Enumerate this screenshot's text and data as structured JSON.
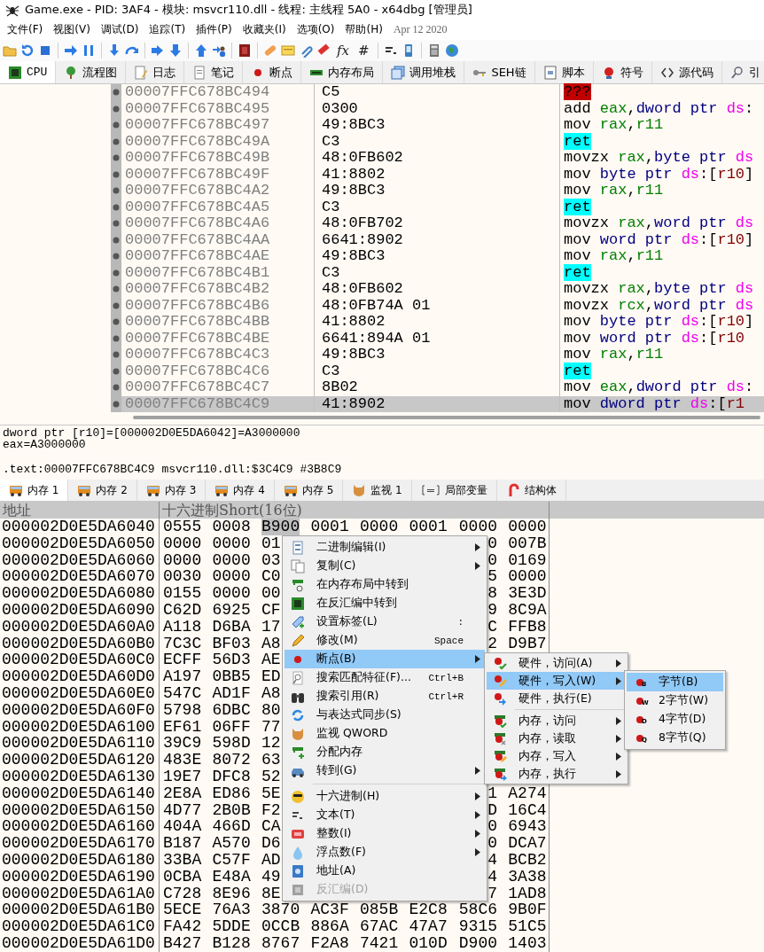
{
  "window": {
    "title": "Game.exe - PID: 3AF4 - 模块: msvcr110.dll - 线程: 主线程 5A0 - x64dbg [管理员]"
  },
  "menu_bar": {
    "items": [
      "文件(F)",
      "视图(V)",
      "调试(D)",
      "追踪(T)",
      "插件(P)",
      "收藏夹(I)",
      "选项(O)",
      "帮助(H)"
    ],
    "build_date": "Apr 12 2020"
  },
  "toolbar": {
    "text_buttons": [
      "fx",
      "#"
    ]
  },
  "tabs": [
    {
      "label": "CPU",
      "selected": true
    },
    {
      "label": "流程图",
      "selected": false
    },
    {
      "label": "日志",
      "selected": false
    },
    {
      "label": "笔记",
      "selected": false
    },
    {
      "label": "断点",
      "selected": false
    },
    {
      "label": "内存布局",
      "selected": false
    },
    {
      "label": "调用堆栈",
      "selected": false
    },
    {
      "label": "SEH链",
      "selected": false
    },
    {
      "label": "脚本",
      "selected": false
    },
    {
      "label": "符号",
      "selected": false
    },
    {
      "label": "源代码",
      "selected": false
    },
    {
      "label": "引",
      "selected": false
    }
  ],
  "disassembly": {
    "rows": [
      {
        "address": "00007FFC678BC494",
        "bytes": "C5",
        "selected": false,
        "instruction": [
          {
            "text": "???",
            "kind": "bad"
          }
        ]
      },
      {
        "address": "00007FFC678BC495",
        "bytes": "0300",
        "selected": false,
        "instruction": [
          {
            "text": "add ",
            "kind": "op"
          },
          {
            "text": "eax",
            "kind": "reg"
          },
          {
            "text": ",",
            "kind": "punct"
          },
          {
            "text": "dword ptr ",
            "kind": "size"
          },
          {
            "text": "ds",
            "kind": "seg"
          },
          {
            "text": ":",
            "kind": "punct"
          }
        ]
      },
      {
        "address": "00007FFC678BC497",
        "bytes": "49:8BC3",
        "selected": false,
        "instruction": [
          {
            "text": "mov ",
            "kind": "op"
          },
          {
            "text": "rax",
            "kind": "reg"
          },
          {
            "text": ",",
            "kind": "punct"
          },
          {
            "text": "r11",
            "kind": "reg"
          }
        ]
      },
      {
        "address": "00007FFC678BC49A",
        "bytes": "C3",
        "selected": false,
        "instruction": [
          {
            "text": "ret",
            "kind": "ret"
          }
        ]
      },
      {
        "address": "00007FFC678BC49B",
        "bytes": "48:0FB602",
        "selected": false,
        "instruction": [
          {
            "text": "movzx ",
            "kind": "op"
          },
          {
            "text": "rax",
            "kind": "reg"
          },
          {
            "text": ",",
            "kind": "punct"
          },
          {
            "text": "byte ptr ",
            "kind": "size"
          },
          {
            "text": "ds",
            "kind": "seg"
          }
        ]
      },
      {
        "address": "00007FFC678BC49F",
        "bytes": "41:8802",
        "selected": false,
        "instruction": [
          {
            "text": "mov ",
            "kind": "op"
          },
          {
            "text": "byte ptr ",
            "kind": "size"
          },
          {
            "text": "ds",
            "kind": "seg"
          },
          {
            "text": ":[",
            "kind": "punct"
          },
          {
            "text": "r10",
            "kind": "mem"
          },
          {
            "text": "]",
            "kind": "punct"
          }
        ]
      },
      {
        "address": "00007FFC678BC4A2",
        "bytes": "49:8BC3",
        "selected": false,
        "instruction": [
          {
            "text": "mov ",
            "kind": "op"
          },
          {
            "text": "rax",
            "kind": "reg"
          },
          {
            "text": ",",
            "kind": "punct"
          },
          {
            "text": "r11",
            "kind": "reg"
          }
        ]
      },
      {
        "address": "00007FFC678BC4A5",
        "bytes": "C3",
        "selected": false,
        "instruction": [
          {
            "text": "ret",
            "kind": "ret"
          }
        ]
      },
      {
        "address": "00007FFC678BC4A6",
        "bytes": "48:0FB702",
        "selected": false,
        "instruction": [
          {
            "text": "movzx ",
            "kind": "op"
          },
          {
            "text": "rax",
            "kind": "reg"
          },
          {
            "text": ",",
            "kind": "punct"
          },
          {
            "text": "word ptr ",
            "kind": "size"
          },
          {
            "text": "ds",
            "kind": "seg"
          }
        ]
      },
      {
        "address": "00007FFC678BC4AA",
        "bytes": "6641:8902",
        "selected": false,
        "instruction": [
          {
            "text": "mov ",
            "kind": "op"
          },
          {
            "text": "word ptr ",
            "kind": "size"
          },
          {
            "text": "ds",
            "kind": "seg"
          },
          {
            "text": ":[",
            "kind": "punct"
          },
          {
            "text": "r10",
            "kind": "mem"
          },
          {
            "text": "]",
            "kind": "punct"
          }
        ]
      },
      {
        "address": "00007FFC678BC4AE",
        "bytes": "49:8BC3",
        "selected": false,
        "instruction": [
          {
            "text": "mov ",
            "kind": "op"
          },
          {
            "text": "rax",
            "kind": "reg"
          },
          {
            "text": ",",
            "kind": "punct"
          },
          {
            "text": "r11",
            "kind": "reg"
          }
        ]
      },
      {
        "address": "00007FFC678BC4B1",
        "bytes": "C3",
        "selected": false,
        "instruction": [
          {
            "text": "ret",
            "kind": "ret"
          }
        ]
      },
      {
        "address": "00007FFC678BC4B2",
        "bytes": "48:0FB602",
        "selected": false,
        "instruction": [
          {
            "text": "movzx ",
            "kind": "op"
          },
          {
            "text": "rax",
            "kind": "reg"
          },
          {
            "text": ",",
            "kind": "punct"
          },
          {
            "text": "byte ptr ",
            "kind": "size"
          },
          {
            "text": "ds",
            "kind": "seg"
          }
        ]
      },
      {
        "address": "00007FFC678BC4B6",
        "bytes": "48:0FB74A 01",
        "selected": false,
        "instruction": [
          {
            "text": "movzx ",
            "kind": "op"
          },
          {
            "text": "rcx",
            "kind": "reg"
          },
          {
            "text": ",",
            "kind": "punct"
          },
          {
            "text": "word ptr ",
            "kind": "size"
          },
          {
            "text": "ds",
            "kind": "seg"
          }
        ]
      },
      {
        "address": "00007FFC678BC4BB",
        "bytes": "41:8802",
        "selected": false,
        "instruction": [
          {
            "text": "mov ",
            "kind": "op"
          },
          {
            "text": "byte ptr ",
            "kind": "size"
          },
          {
            "text": "ds",
            "kind": "seg"
          },
          {
            "text": ":[",
            "kind": "punct"
          },
          {
            "text": "r10",
            "kind": "mem"
          },
          {
            "text": "]",
            "kind": "punct"
          }
        ]
      },
      {
        "address": "00007FFC678BC4BE",
        "bytes": "6641:894A 01",
        "selected": false,
        "instruction": [
          {
            "text": "mov ",
            "kind": "op"
          },
          {
            "text": "word ptr ",
            "kind": "size"
          },
          {
            "text": "ds",
            "kind": "seg"
          },
          {
            "text": ":[",
            "kind": "punct"
          },
          {
            "text": "r10",
            "kind": "mem"
          }
        ]
      },
      {
        "address": "00007FFC678BC4C3",
        "bytes": "49:8BC3",
        "selected": false,
        "instruction": [
          {
            "text": "mov ",
            "kind": "op"
          },
          {
            "text": "rax",
            "kind": "reg"
          },
          {
            "text": ",",
            "kind": "punct"
          },
          {
            "text": "r11",
            "kind": "reg"
          }
        ]
      },
      {
        "address": "00007FFC678BC4C6",
        "bytes": "C3",
        "selected": false,
        "instruction": [
          {
            "text": "ret",
            "kind": "ret"
          }
        ]
      },
      {
        "address": "00007FFC678BC4C7",
        "bytes": "8B02",
        "selected": false,
        "instruction": [
          {
            "text": "mov ",
            "kind": "op"
          },
          {
            "text": "eax",
            "kind": "reg"
          },
          {
            "text": ",",
            "kind": "punct"
          },
          {
            "text": "dword ptr ",
            "kind": "size"
          },
          {
            "text": "ds",
            "kind": "seg"
          },
          {
            "text": ":",
            "kind": "punct"
          }
        ]
      },
      {
        "address": "00007FFC678BC4C9",
        "bytes": "41:8902",
        "selected": true,
        "instruction": [
          {
            "text": "mov ",
            "kind": "op"
          },
          {
            "text": "dword ptr ",
            "kind": "size"
          },
          {
            "text": "ds",
            "kind": "seg"
          },
          {
            "text": ":[",
            "kind": "punct"
          },
          {
            "text": "r1",
            "kind": "mem"
          }
        ]
      }
    ]
  },
  "info": {
    "lines": [
      "dword ptr [r10]=[000002D0E5DA6042]=A3000000",
      "eax=A3000000"
    ],
    "location": ".text:00007FFC678BC4C9 msvcr110.dll:$3C4C9 #3B8C9"
  },
  "memory_tabs": [
    {
      "label": "内存 1",
      "selected": true
    },
    {
      "label": "内存 2",
      "selected": false
    },
    {
      "label": "内存 3",
      "selected": false
    },
    {
      "label": "内存 4",
      "selected": false
    },
    {
      "label": "内存 5",
      "selected": false
    },
    {
      "label": "监视 1",
      "selected": false
    },
    {
      "label": "局部变量",
      "selected": false
    },
    {
      "label": "结构体",
      "selected": false
    }
  ],
  "memory": {
    "columns": [
      "地址",
      "十六进制Short(16位)"
    ],
    "rows": [
      {
        "address": "000002D0E5DA6040",
        "cells": [
          {
            "t": "0555",
            "sel": false
          },
          {
            "t": "0008",
            "sel": false
          },
          {
            "t": "B900",
            "sel": true
          },
          {
            "t": "0001",
            "sel": false
          },
          {
            "t": "0000",
            "sel": false
          },
          {
            "t": "0001",
            "sel": false
          },
          {
            "t": "0000",
            "sel": false
          },
          {
            "t": "0000",
            "sel": false
          }
        ]
      },
      {
        "address": "000002D0E5DA6050",
        "cells": [
          {
            "t": "0000",
            "sel": false
          },
          {
            "t": "0000",
            "sel": false
          },
          {
            "t": "01",
            "sel": false
          },
          null,
          null,
          null,
          {
            "t": "0",
            "sel": false
          },
          {
            "t": "007B",
            "sel": false
          }
        ]
      },
      {
        "address": "000002D0E5DA6060",
        "cells": [
          {
            "t": "0000",
            "sel": false
          },
          {
            "t": "0000",
            "sel": false
          },
          {
            "t": "03",
            "sel": false
          },
          null,
          null,
          null,
          {
            "t": "0",
            "sel": false
          },
          {
            "t": "0169",
            "sel": false
          }
        ]
      },
      {
        "address": "000002D0E5DA6070",
        "cells": [
          {
            "t": "0030",
            "sel": false
          },
          {
            "t": "0000",
            "sel": false
          },
          {
            "t": "C0",
            "sel": false
          },
          null,
          null,
          null,
          {
            "t": "5",
            "sel": false
          },
          {
            "t": "0000",
            "sel": false
          }
        ]
      },
      {
        "address": "000002D0E5DA6080",
        "cells": [
          {
            "t": "0155",
            "sel": false
          },
          {
            "t": "0000",
            "sel": false
          },
          {
            "t": "00",
            "sel": false
          },
          null,
          null,
          null,
          {
            "t": "8",
            "sel": false
          },
          {
            "t": "3E3D",
            "sel": false
          }
        ]
      },
      {
        "address": "000002D0E5DA6090",
        "cells": [
          {
            "t": "C62D",
            "sel": false
          },
          {
            "t": "6925",
            "sel": false
          },
          {
            "t": "CF",
            "sel": false
          },
          null,
          null,
          null,
          {
            "t": "9",
            "sel": false
          },
          {
            "t": "8C9A",
            "sel": false
          }
        ]
      },
      {
        "address": "000002D0E5DA60A0",
        "cells": [
          {
            "t": "A118",
            "sel": false
          },
          {
            "t": "D6BA",
            "sel": false
          },
          {
            "t": "17",
            "sel": false
          },
          null,
          null,
          null,
          {
            "t": "C",
            "sel": false
          },
          {
            "t": "FFB8",
            "sel": false
          }
        ]
      },
      {
        "address": "000002D0E5DA60B0",
        "cells": [
          {
            "t": "7C3C",
            "sel": false
          },
          {
            "t": "BF03",
            "sel": false
          },
          {
            "t": "A8",
            "sel": false
          },
          null,
          null,
          null,
          {
            "t": "2",
            "sel": false
          },
          {
            "t": "D9B7",
            "sel": false
          }
        ]
      },
      {
        "address": "000002D0E5DA60C0",
        "cells": [
          {
            "t": "ECFF",
            "sel": false
          },
          {
            "t": "56D3",
            "sel": false
          },
          {
            "t": "AE",
            "sel": false
          },
          null,
          null,
          null,
          null,
          null
        ]
      },
      {
        "address": "000002D0E5DA60D0",
        "cells": [
          {
            "t": "A197",
            "sel": false
          },
          {
            "t": "0BB5",
            "sel": false
          },
          {
            "t": "ED",
            "sel": false
          },
          null,
          null,
          null,
          null,
          null
        ]
      },
      {
        "address": "000002D0E5DA60E0",
        "cells": [
          {
            "t": "547C",
            "sel": false
          },
          {
            "t": "AD1F",
            "sel": false
          },
          {
            "t": "A8",
            "sel": false
          },
          null,
          null,
          null,
          null,
          null
        ]
      },
      {
        "address": "000002D0E5DA60F0",
        "cells": [
          {
            "t": "5798",
            "sel": false
          },
          {
            "t": "6DBC",
            "sel": false
          },
          {
            "t": "80",
            "sel": false
          },
          null,
          null,
          null,
          null,
          null
        ]
      },
      {
        "address": "000002D0E5DA6100",
        "cells": [
          {
            "t": "EF61",
            "sel": false
          },
          {
            "t": "06FF",
            "sel": false
          },
          {
            "t": "77",
            "sel": false
          },
          null,
          null,
          null,
          null,
          null
        ]
      },
      {
        "address": "000002D0E5DA6110",
        "cells": [
          {
            "t": "39C9",
            "sel": false
          },
          {
            "t": "598D",
            "sel": false
          },
          {
            "t": "12",
            "sel": false
          },
          null,
          null,
          null,
          null,
          null
        ]
      },
      {
        "address": "000002D0E5DA6120",
        "cells": [
          {
            "t": "483E",
            "sel": false
          },
          {
            "t": "8072",
            "sel": false
          },
          {
            "t": "63",
            "sel": false
          },
          null,
          null,
          null,
          null,
          null
        ]
      },
      {
        "address": "000002D0E5DA6130",
        "cells": [
          {
            "t": "19E7",
            "sel": false
          },
          {
            "t": "DFC8",
            "sel": false
          },
          {
            "t": "52",
            "sel": false
          },
          null,
          null,
          null,
          null,
          null
        ]
      },
      {
        "address": "000002D0E5DA6140",
        "cells": [
          {
            "t": "2E8A",
            "sel": false
          },
          {
            "t": "ED86",
            "sel": false
          },
          {
            "t": "5E",
            "sel": false
          },
          null,
          null,
          null,
          {
            "t": "1",
            "sel": false
          },
          {
            "t": "A274",
            "sel": false
          }
        ]
      },
      {
        "address": "000002D0E5DA6150",
        "cells": [
          {
            "t": "4D77",
            "sel": false
          },
          {
            "t": "2B0B",
            "sel": false
          },
          {
            "t": "F2",
            "sel": false
          },
          null,
          null,
          null,
          {
            "t": "D",
            "sel": false
          },
          {
            "t": "16C4",
            "sel": false
          }
        ]
      },
      {
        "address": "000002D0E5DA6160",
        "cells": [
          {
            "t": "404A",
            "sel": false
          },
          {
            "t": "466D",
            "sel": false
          },
          {
            "t": "CA",
            "sel": false
          },
          null,
          null,
          null,
          {
            "t": "0",
            "sel": false
          },
          {
            "t": "6943",
            "sel": false
          }
        ]
      },
      {
        "address": "000002D0E5DA6170",
        "cells": [
          {
            "t": "B187",
            "sel": false
          },
          {
            "t": "A570",
            "sel": false
          },
          {
            "t": "D6",
            "sel": false
          },
          null,
          null,
          null,
          {
            "t": "0",
            "sel": false
          },
          {
            "t": "DCA7",
            "sel": false
          }
        ]
      },
      {
        "address": "000002D0E5DA6180",
        "cells": [
          {
            "t": "33BA",
            "sel": false
          },
          {
            "t": "C57F",
            "sel": false
          },
          {
            "t": "AD",
            "sel": false
          },
          null,
          null,
          null,
          {
            "t": "4",
            "sel": false
          },
          {
            "t": "BCB2",
            "sel": false
          }
        ]
      },
      {
        "address": "000002D0E5DA6190",
        "cells": [
          {
            "t": "0CBA",
            "sel": false
          },
          {
            "t": "E48A",
            "sel": false
          },
          {
            "t": "49",
            "sel": false
          },
          null,
          null,
          null,
          {
            "t": "4",
            "sel": false
          },
          {
            "t": "3A38",
            "sel": false
          }
        ]
      },
      {
        "address": "000002D0E5DA61A0",
        "cells": [
          {
            "t": "C728",
            "sel": false
          },
          {
            "t": "8E96",
            "sel": false
          },
          {
            "t": "8E",
            "sel": false
          },
          null,
          null,
          null,
          {
            "t": "7",
            "sel": false
          },
          {
            "t": "1AD8",
            "sel": false
          }
        ]
      },
      {
        "address": "000002D0E5DA61B0",
        "cells": [
          {
            "t": "5ECE",
            "sel": false
          },
          {
            "t": "76A3",
            "sel": false
          },
          {
            "t": "3870",
            "sel": false
          },
          {
            "t": "AC3F",
            "sel": false
          },
          {
            "t": "085B",
            "sel": false
          },
          {
            "t": "E2C8",
            "sel": false
          },
          {
            "t": "58C6",
            "sel": false
          },
          {
            "t": "9B0F",
            "sel": false
          }
        ]
      },
      {
        "address": "000002D0E5DA61C0",
        "cells": [
          {
            "t": "FA42",
            "sel": false
          },
          {
            "t": "5DDE",
            "sel": false
          },
          {
            "t": "0CCB",
            "sel": false
          },
          {
            "t": "886A",
            "sel": false
          },
          {
            "t": "67AC",
            "sel": false
          },
          {
            "t": "47A7",
            "sel": false
          },
          {
            "t": "9315",
            "sel": false
          },
          {
            "t": "51C5",
            "sel": false
          }
        ]
      },
      {
        "address": "000002D0E5DA61D0",
        "cells": [
          {
            "t": "B427",
            "sel": false
          },
          {
            "t": "B128",
            "sel": false
          },
          {
            "t": "8767",
            "sel": false
          },
          {
            "t": "F2A8",
            "sel": false
          },
          {
            "t": "7421",
            "sel": false
          },
          {
            "t": "010D",
            "sel": false
          },
          {
            "t": "D900",
            "sel": false
          },
          {
            "t": "1403",
            "sel": false
          }
        ]
      }
    ]
  },
  "context_menu": {
    "items": [
      {
        "kind": "item",
        "label": "二进制编辑(I)",
        "submenu": true,
        "selected": false,
        "disabled": false
      },
      {
        "kind": "item",
        "label": "复制(C)",
        "submenu": true,
        "selected": false,
        "disabled": false
      },
      {
        "kind": "item",
        "label": "在内存布局中转到",
        "submenu": false,
        "selected": false,
        "disabled": false
      },
      {
        "kind": "item",
        "label": "在反汇编中转到",
        "submenu": false,
        "selected": false,
        "disabled": false
      },
      {
        "kind": "item",
        "label": "设置标签(L)",
        "shortcut": ":",
        "submenu": false,
        "selected": false,
        "disabled": false
      },
      {
        "kind": "item",
        "label": "修改(M)",
        "shortcut": "Space",
        "submenu": false,
        "selected": false,
        "disabled": false
      },
      {
        "kind": "item",
        "label": "断点(B)",
        "submenu": true,
        "selected": true,
        "disabled": false
      },
      {
        "kind": "item",
        "label": "搜索匹配特征(F)...",
        "shortcut": "Ctrl+B",
        "submenu": false,
        "selected": false,
        "disabled": false
      },
      {
        "kind": "item",
        "label": "搜索引用(R)",
        "shortcut": "Ctrl+R",
        "submenu": false,
        "selected": false,
        "disabled": false
      },
      {
        "kind": "item",
        "label": "与表达式同步(S)",
        "submenu": false,
        "selected": false,
        "disabled": false
      },
      {
        "kind": "item",
        "label": "监视 QWORD",
        "submenu": false,
        "selected": false,
        "disabled": false
      },
      {
        "kind": "item",
        "label": "分配内存",
        "submenu": false,
        "selected": false,
        "disabled": false
      },
      {
        "kind": "item",
        "label": "转到(G)",
        "submenu": true,
        "selected": false,
        "disabled": false
      },
      {
        "kind": "separator"
      },
      {
        "kind": "item",
        "label": "十六进制(H)",
        "submenu": true,
        "selected": false,
        "disabled": false
      },
      {
        "kind": "item",
        "label": "文本(T)",
        "submenu": true,
        "selected": false,
        "disabled": false
      },
      {
        "kind": "item",
        "label": "整数(I)",
        "submenu": true,
        "selected": false,
        "disabled": false
      },
      {
        "kind": "item",
        "label": "浮点数(F)",
        "submenu": true,
        "selected": false,
        "disabled": false
      },
      {
        "kind": "item",
        "label": "地址(A)",
        "submenu": false,
        "selected": false,
        "disabled": false
      },
      {
        "kind": "item",
        "label": "反汇编(D)",
        "submenu": false,
        "selected": false,
        "disabled": true
      }
    ]
  },
  "breakpoint_submenu": {
    "items": [
      {
        "kind": "item",
        "label": "硬件，访问(A)",
        "submenu": true,
        "selected": false
      },
      {
        "kind": "item",
        "label": "硬件，写入(W)",
        "submenu": true,
        "selected": true
      },
      {
        "kind": "item",
        "label": "硬件，执行(E)",
        "submenu": false,
        "selected": false
      },
      {
        "kind": "separator"
      },
      {
        "kind": "item",
        "label": "内存，访问",
        "submenu": true,
        "selected": false
      },
      {
        "kind": "item",
        "label": "内存，读取",
        "submenu": true,
        "selected": false
      },
      {
        "kind": "item",
        "label": "内存，写入",
        "submenu": true,
        "selected": false
      },
      {
        "kind": "item",
        "label": "内存，执行",
        "submenu": true,
        "selected": false
      }
    ]
  },
  "size_submenu": {
    "items": [
      {
        "label": "字节(B)",
        "icon_letter": "B",
        "selected": true
      },
      {
        "label": "2字节(W)",
        "icon_letter": "W",
        "selected": false
      },
      {
        "label": "4字节(D)",
        "icon_letter": "D",
        "selected": false
      },
      {
        "label": "8字节(Q)",
        "icon_letter": "Q",
        "selected": false
      }
    ]
  }
}
